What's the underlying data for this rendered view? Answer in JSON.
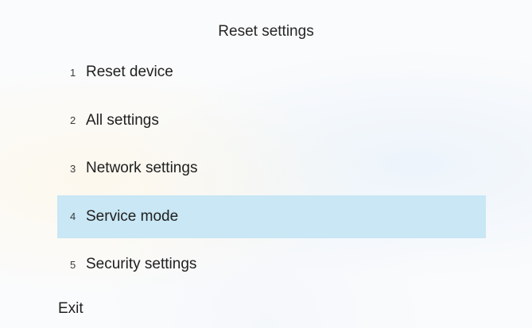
{
  "title": "Reset settings",
  "menu": {
    "selected_index": 3,
    "items": [
      {
        "number": "1",
        "label": "Reset device"
      },
      {
        "number": "2",
        "label": "All settings"
      },
      {
        "number": "3",
        "label": "Network settings"
      },
      {
        "number": "4",
        "label": "Service mode"
      },
      {
        "number": "5",
        "label": "Security settings"
      }
    ]
  },
  "exit_label": "Exit",
  "colors": {
    "selected_background": "#c9e7f5",
    "text": "#202020"
  }
}
